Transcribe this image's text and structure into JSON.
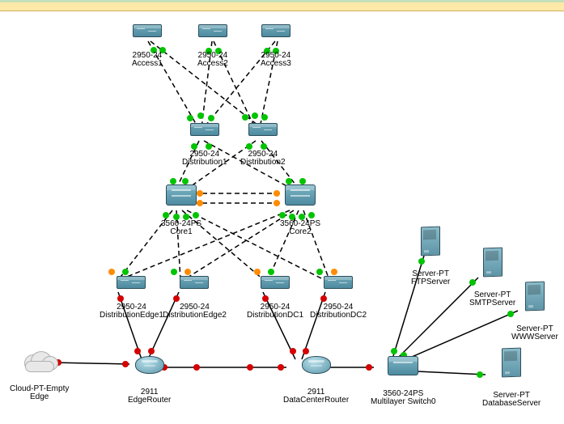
{
  "access1": {
    "l1": "2950-24",
    "l2": "Access1"
  },
  "access2": {
    "l1": "2950-24",
    "l2": "Access2"
  },
  "access3": {
    "l1": "2950-24",
    "l2": "Access3"
  },
  "dist1": {
    "l1": "2950-24",
    "l2": "Distribution1"
  },
  "dist2": {
    "l1": "2950-24",
    "l2": "Distribution2"
  },
  "core1": {
    "l1": "3560-24PS",
    "l2": "Core1"
  },
  "core2": {
    "l1": "3560-24PS",
    "l2": "Core2"
  },
  "de1": {
    "l1": "2950-24",
    "l2": "DistributionEdge1"
  },
  "de2": {
    "l1": "2950-24",
    "l2": "DistributionEdge2"
  },
  "ddc1": {
    "l1": "2950-24",
    "l2": "DistributionDC1"
  },
  "ddc2": {
    "l1": "2950-24",
    "l2": "DistributionDC2"
  },
  "cloud": {
    "l1": "Cloud-PT-Empty",
    "l2": "Edge"
  },
  "edgeR": {
    "l1": "2911",
    "l2": "EdgeRouter"
  },
  "dcR": {
    "l1": "2911",
    "l2": "DataCenterRouter"
  },
  "mls0": {
    "l1": "3560-24PS",
    "l2": "Multilayer Switch0"
  },
  "ftp": {
    "l1": "Server-PT",
    "l2": "FTPServer"
  },
  "smtp": {
    "l1": "Server-PT",
    "l2": "SMTPServer"
  },
  "www": {
    "l1": "Server-PT",
    "l2": "WWWServer"
  },
  "db": {
    "l1": "Server-PT",
    "l2": "DatabaseServer"
  }
}
